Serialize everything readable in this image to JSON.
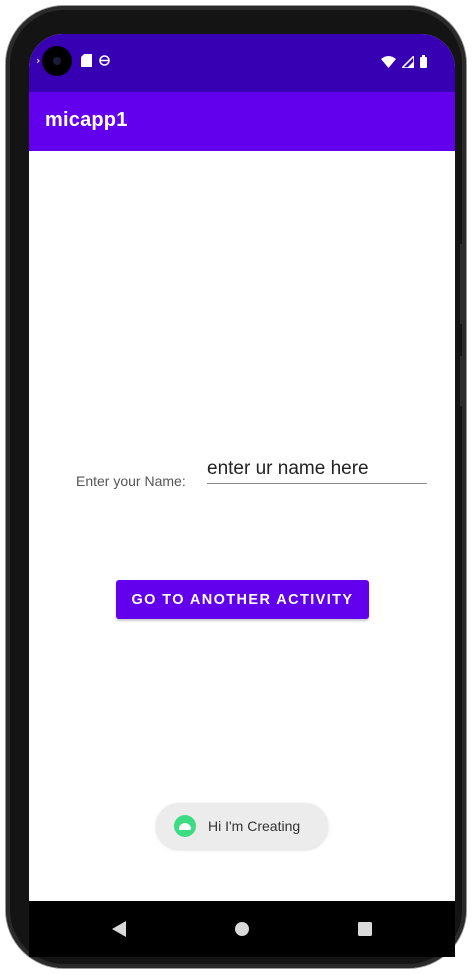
{
  "status_bar": {
    "icons": [
      "camera-cutout",
      "notification-icon",
      "sync-icon",
      "wifi-icon",
      "signal-icon",
      "battery-icon"
    ]
  },
  "app_bar": {
    "title": "micapp1"
  },
  "form": {
    "name_label": "Enter your Name:",
    "name_placeholder": "enter ur name here"
  },
  "actions": {
    "go_button_label": "GO TO ANOTHER ACTIVITY"
  },
  "toast": {
    "text": "Hi I'm Creating",
    "icon": "android-icon"
  },
  "nav_bar": {
    "icons": [
      "back-icon",
      "home-icon",
      "recents-icon"
    ]
  },
  "colors": {
    "status_bar": "#3700b3",
    "app_bar": "#6200ee",
    "button": "#6200ee",
    "toast_icon": "#3ddc84"
  }
}
